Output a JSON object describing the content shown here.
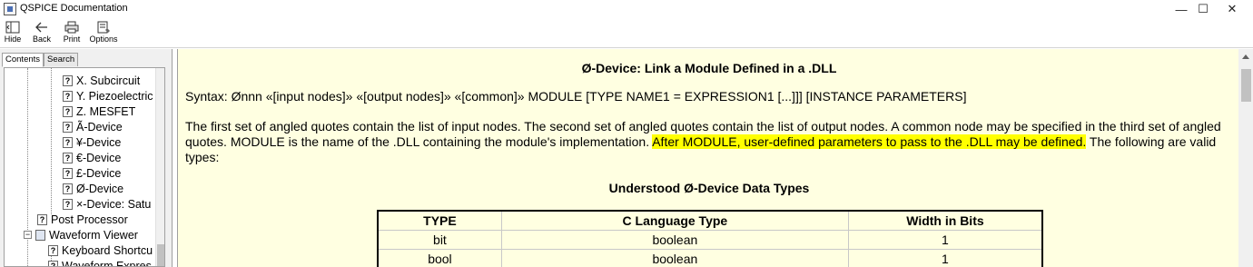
{
  "window": {
    "title": "QSPICE Documentation",
    "minimize_glyph": "—",
    "maximize_glyph": "☐",
    "close_glyph": "✕"
  },
  "toolbar": {
    "hide_label": "Hide",
    "back_label": "Back",
    "print_label": "Print",
    "options_label": "Options"
  },
  "nav": {
    "tabs": [
      "Contents",
      "Search"
    ],
    "active_tab": "Contents",
    "tree": [
      {
        "label": "X. Subcircuit",
        "icon": "help-page-icon"
      },
      {
        "label": "Y. Piezoelectric",
        "icon": "help-page-icon"
      },
      {
        "label": "Z. MESFET",
        "icon": "help-page-icon"
      },
      {
        "label": "Ã-Device",
        "icon": "help-page-icon"
      },
      {
        "label": "¥-Device",
        "icon": "help-page-icon"
      },
      {
        "label": "€-Device",
        "icon": "help-page-icon"
      },
      {
        "label": "£-Device",
        "icon": "help-page-icon"
      },
      {
        "label": "Ø-Device",
        "icon": "help-page-icon",
        "selected": true
      },
      {
        "label": "×-Device: Satu",
        "icon": "help-page-icon"
      },
      {
        "label": "Post Processor",
        "icon": "help-page-icon"
      },
      {
        "label": "Waveform Viewer",
        "icon": "book-icon",
        "expander": "−"
      },
      {
        "label": "Keyboard Shortcu",
        "icon": "help-page-icon"
      },
      {
        "label": "Waveform Expres",
        "icon": "help-page-icon"
      }
    ]
  },
  "doc": {
    "title": "Ø-Device: Link a Module Defined in a .DLL",
    "syntax": "Syntax: Ønnn «[input nodes]» «[output nodes]» «[common]» MODULE [TYPE NAME1 = EXPRESSION1 [...]]] [INSTANCE PARAMETERS]",
    "para_before": "The first set of angled quotes contain the list of input nodes. The second set of angled quotes contain the list of output nodes. A common node may be specified in the third set of angled quotes. MODULE is the name of the .DLL containing the module's implementation. ",
    "para_highlight": "After MODULE, user-defined parameters to pass to the .DLL may be defined.",
    "para_after": " The following are valid types:",
    "highlight_color": "#ffff00",
    "table_title": "Understood Ø-Device Data Types",
    "table": {
      "headers": [
        "TYPE",
        "C Language Type",
        "Width in Bits"
      ],
      "rows": [
        [
          "bit",
          "boolean",
          "1"
        ],
        [
          "bool",
          "boolean",
          "1"
        ]
      ]
    }
  }
}
